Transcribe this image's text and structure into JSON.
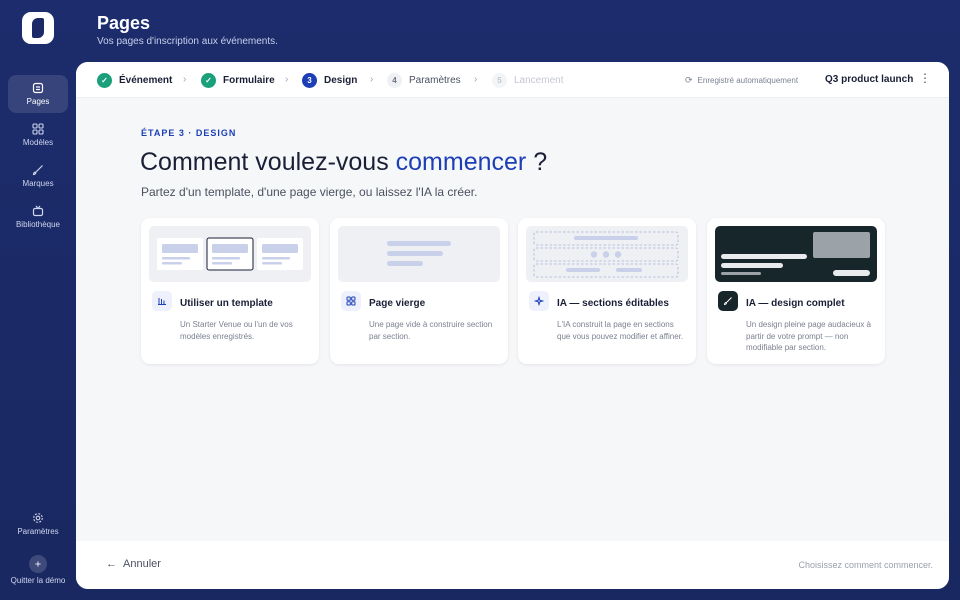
{
  "header": {
    "title": "Pages",
    "subtitle": "Vos pages d'inscription aux événements."
  },
  "sidebar": {
    "items": [
      {
        "label": "Pages",
        "icon": "pages-icon",
        "active": true
      },
      {
        "label": "Modèles",
        "icon": "grid-icon",
        "active": false
      },
      {
        "label": "Marques",
        "icon": "brush-icon",
        "active": false
      },
      {
        "label": "Bibliothèque",
        "icon": "tv-icon",
        "active": false
      }
    ],
    "settings_label": "Paramètres",
    "quit_label": "Quitter la démo"
  },
  "steps": [
    {
      "number": "1",
      "label": "Événement",
      "status": "done"
    },
    {
      "number": "2",
      "label": "Formulaire",
      "status": "done"
    },
    {
      "number": "3",
      "label": "Design",
      "status": "current"
    },
    {
      "number": "4",
      "label": "Paramètres",
      "status": "todo"
    },
    {
      "number": "5",
      "label": "Lancement",
      "status": "disabled"
    }
  ],
  "autosave_label": "Enregistré automatiquement",
  "event_name": "Q3 product launch",
  "content": {
    "eyebrow": "ÉTAPE 3 · DESIGN",
    "headline_start": "Comment voulez-vous ",
    "headline_accent": "commencer",
    "headline_end": " ?",
    "lead": "Partez d'un template, d'une page vierge, ou laissez l'IA la créer."
  },
  "cards": [
    {
      "title": "Utiliser un template",
      "description": "Un Starter Venue ou l'un de vos modèles enregistrés.",
      "icon": "template-icon"
    },
    {
      "title": "Page vierge",
      "description": "Une page vide à construire section par section.",
      "icon": "blank-grid-icon"
    },
    {
      "title": "IA — sections éditables",
      "description": "L'IA construit la page en sections que vous pouvez modifier et affiner.",
      "icon": "ai-sections-icon"
    },
    {
      "title": "IA — design complet",
      "description": "Un design pleine page audacieux à partir de votre prompt — non modifiable par section.",
      "icon": "ai-brush-icon"
    }
  ],
  "footer": {
    "cancel_label": "Annuler",
    "hint": "Choisissez comment commencer."
  },
  "colors": {
    "background": "#1b2a66",
    "accent": "#1d3fb5",
    "success": "#1aa07a",
    "dark_thumb": "#16262b"
  }
}
